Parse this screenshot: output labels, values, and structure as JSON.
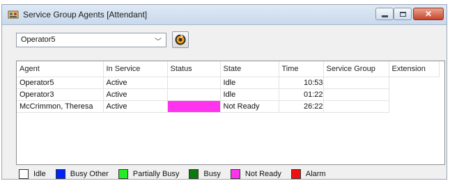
{
  "window": {
    "title": "Service Group Agents [Attendant]",
    "icon": "service-group-icon"
  },
  "operator_select": {
    "value": "Operator5"
  },
  "refresh_button": {
    "icon": "refresh-icon"
  },
  "table": {
    "columns": [
      "Agent",
      "In Service",
      "Status",
      "State",
      "Time",
      "Service Group",
      "Extension"
    ],
    "rows": [
      {
        "agent": "Operator5",
        "in_service": "Active",
        "status": "",
        "status_color": "",
        "state": "Idle",
        "time": "10:53",
        "service_group": "",
        "extension": ""
      },
      {
        "agent": "Operator3",
        "in_service": "Active",
        "status": "",
        "status_color": "",
        "state": "Idle",
        "time": "01:22",
        "service_group": "",
        "extension": ""
      },
      {
        "agent": "McCrimmon, Theresa",
        "in_service": "Active",
        "status": "",
        "status_color": "#ff33ee",
        "state": "Not Ready",
        "time": "26:22",
        "service_group": "",
        "extension": ""
      }
    ]
  },
  "legend": [
    {
      "label": "Idle",
      "color": "#ffffff"
    },
    {
      "label": "Busy Other",
      "color": "#0022ff"
    },
    {
      "label": "Partially Busy",
      "color": "#22ee22"
    },
    {
      "label": "Busy",
      "color": "#0a7a0a"
    },
    {
      "label": "Not Ready",
      "color": "#ff33ee"
    },
    {
      "label": "Alarm",
      "color": "#ee1111"
    }
  ]
}
